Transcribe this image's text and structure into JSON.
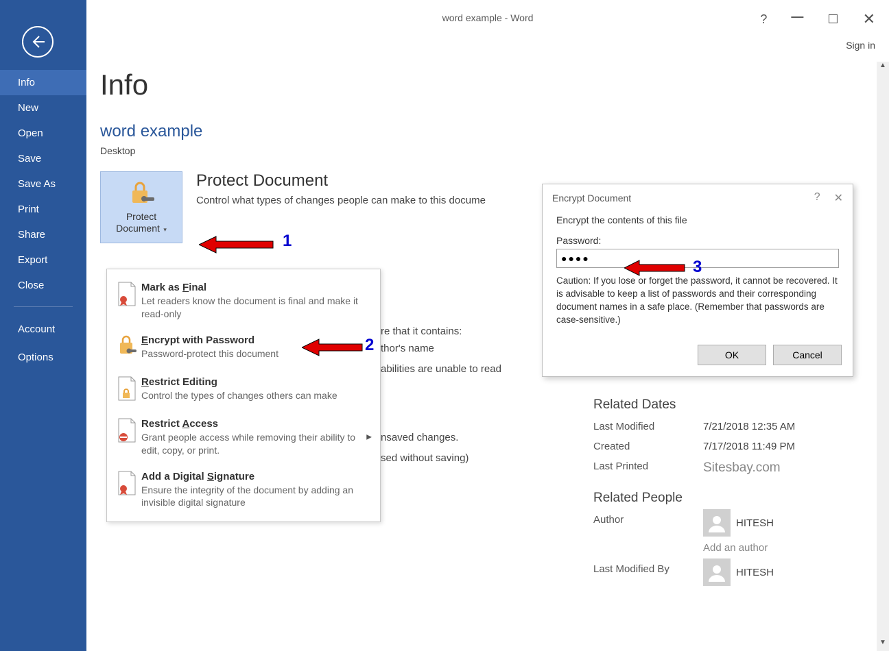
{
  "window": {
    "title": "word example - Word",
    "signin": "Sign in"
  },
  "sidebar": {
    "items": [
      "Info",
      "New",
      "Open",
      "Save",
      "Save As",
      "Print",
      "Share",
      "Export",
      "Close"
    ],
    "lower": [
      "Account",
      "Options"
    ]
  },
  "page": {
    "title": "Info",
    "doc_name": "word example",
    "doc_location": "Desktop"
  },
  "protect": {
    "btn_label_1": "Protect",
    "btn_label_2": "Document",
    "heading": "Protect Document",
    "desc": "Control what types of changes people can make to this docume"
  },
  "dropdown": [
    {
      "title_pre": "Mark as ",
      "title_u": "F",
      "title_post": "inal",
      "desc": "Let readers know the document is final and make it read-only"
    },
    {
      "title_pre": "",
      "title_u": "E",
      "title_post": "ncrypt with Password",
      "desc": "Password-protect this document"
    },
    {
      "title_pre": "",
      "title_u": "R",
      "title_post": "estrict Editing",
      "desc": "Control the types of changes others can make"
    },
    {
      "title_pre": "Restrict ",
      "title_u": "A",
      "title_post": "ccess",
      "desc": "Grant people access while removing their ability to edit, copy, or print.",
      "arrow": true
    },
    {
      "title_pre": "Add a Digital ",
      "title_u": "S",
      "title_post": "ignature",
      "desc": "Ensure the integrity of the document by adding an invisible digital signature"
    }
  ],
  "peek": {
    "p1": "re that it contains:",
    "p2": "thor's name",
    "p3": "abilities are unable to read",
    "p4": "nsaved changes.",
    "p5": "sed without saving)"
  },
  "dialog": {
    "title": "Encrypt Document",
    "instr": "Encrypt the contents of this file",
    "pwd_label": "Password:",
    "pwd_value": "●●●●",
    "caution": "Caution: If you lose or forget the password, it cannot be recovered. It is advisable to keep a list of passwords and their corresponding document names in a safe place. (Remember that passwords are case-sensitive.)",
    "ok": "OK",
    "cancel": "Cancel"
  },
  "props": {
    "dates_heading": "Related Dates",
    "rows": [
      {
        "label": "Last Modified",
        "val": "7/21/2018 12:35 AM"
      },
      {
        "label": "Created",
        "val": "7/17/2018 11:49 PM"
      },
      {
        "label": "Last Printed",
        "val": "Sitesbay.com",
        "brand": true
      }
    ],
    "people_heading": "Related People",
    "author_label": "Author",
    "author_name": "HITESH",
    "add_author": "Add an author",
    "modby_label": "Last Modified By",
    "modby_name": "HITESH"
  },
  "annotations": {
    "n1": "1",
    "n2": "2",
    "n3": "3"
  }
}
